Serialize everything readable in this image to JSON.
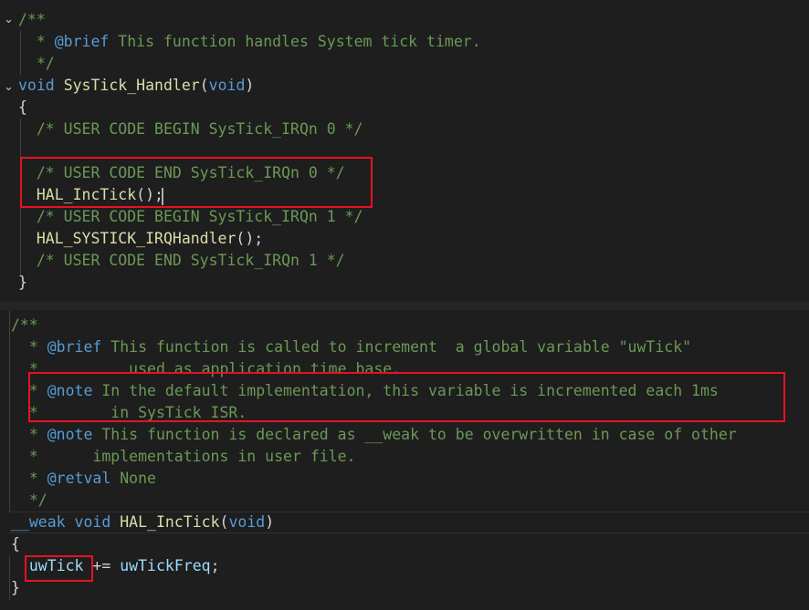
{
  "top": {
    "lines": [
      [
        {
          "t": "/**",
          "c": "cm"
        }
      ],
      [
        {
          "t": "  * ",
          "c": "cm"
        },
        {
          "t": "@brief",
          "c": "tag"
        },
        {
          "t": " This function handles System tick timer.",
          "c": "cm"
        }
      ],
      [
        {
          "t": "  */",
          "c": "cm"
        }
      ],
      [
        {
          "t": "void",
          "c": "kw"
        },
        {
          "t": " ",
          "c": "pun"
        },
        {
          "t": "SysTick_Handler",
          "c": "fn"
        },
        {
          "t": "(",
          "c": "pun"
        },
        {
          "t": "void",
          "c": "kw"
        },
        {
          "t": ")",
          "c": "pun"
        }
      ],
      [
        {
          "t": "{",
          "c": "pun"
        }
      ],
      [
        {
          "t": "  /* USER CODE BEGIN SysTick_IRQn 0 */",
          "c": "cm"
        }
      ],
      [
        {
          "t": "",
          "c": "pun"
        }
      ],
      [
        {
          "t": "  /* USER CODE END SysTick_IRQn 0 */",
          "c": "cm"
        }
      ],
      [
        {
          "t": "  ",
          "c": "pun"
        },
        {
          "t": "HAL_IncTick",
          "c": "fn"
        },
        {
          "t": "();",
          "c": "pun"
        }
      ],
      [
        {
          "t": "  /* USER CODE BEGIN SysTick_IRQn 1 */",
          "c": "cm"
        }
      ],
      [
        {
          "t": "  ",
          "c": "pun"
        },
        {
          "t": "HAL_SYSTICK_IRQHandler",
          "c": "fn"
        },
        {
          "t": "();",
          "c": "pun"
        }
      ],
      [
        {
          "t": "  /* USER CODE END SysTick_IRQn 1 */",
          "c": "cm"
        }
      ],
      [
        {
          "t": "}",
          "c": "pun"
        }
      ]
    ]
  },
  "bottom": {
    "lines": [
      [
        {
          "t": "/**",
          "c": "cm"
        }
      ],
      [
        {
          "t": "  * ",
          "c": "cm"
        },
        {
          "t": "@brief",
          "c": "tag"
        },
        {
          "t": " This function is called to increment  a global variable \"uwTick\"",
          "c": "cm"
        }
      ],
      [
        {
          "t": "  *          used as application time base.",
          "c": "cm"
        }
      ],
      [
        {
          "t": "  * ",
          "c": "cm"
        },
        {
          "t": "@note",
          "c": "tag"
        },
        {
          "t": " In the default implementation, this variable is incremented each 1ms",
          "c": "cm"
        }
      ],
      [
        {
          "t": "  *        in SysTick ISR.",
          "c": "cm"
        }
      ],
      [
        {
          "t": "  * ",
          "c": "cm"
        },
        {
          "t": "@note",
          "c": "tag"
        },
        {
          "t": " This function is declared as __weak to be overwritten in case of other",
          "c": "cm"
        }
      ],
      [
        {
          "t": "  *      implementations in user file.",
          "c": "cm"
        }
      ],
      [
        {
          "t": "  * ",
          "c": "cm"
        },
        {
          "t": "@retval",
          "c": "tag"
        },
        {
          "t": " None",
          "c": "cm"
        }
      ],
      [
        {
          "t": "  */",
          "c": "cm"
        }
      ],
      [
        {
          "t": "__weak",
          "c": "kw"
        },
        {
          "t": " ",
          "c": "pun"
        },
        {
          "t": "void",
          "c": "kw"
        },
        {
          "t": " ",
          "c": "pun"
        },
        {
          "t": "HAL_IncTick",
          "c": "fn"
        },
        {
          "t": "(",
          "c": "pun"
        },
        {
          "t": "void",
          "c": "kw"
        },
        {
          "t": ")",
          "c": "pun"
        }
      ],
      [
        {
          "t": "{",
          "c": "pun"
        }
      ],
      [
        {
          "t": "  ",
          "c": "pun"
        },
        {
          "t": "uwTick",
          "c": "var"
        },
        {
          "t": " += ",
          "c": "pun"
        },
        {
          "t": "uwTickFreq",
          "c": "var"
        },
        {
          "t": ";",
          "c": "pun"
        }
      ],
      [
        {
          "t": "}",
          "c": "pun"
        }
      ]
    ]
  },
  "colors": {
    "background": "#1e1e1e",
    "comment": "#6a9955",
    "keyword": "#569cd6",
    "function": "#dcdcaa",
    "variable": "#9cdcfe",
    "highlight_box": "#e81123"
  },
  "icons": {
    "fold": "chevron-down-icon"
  }
}
